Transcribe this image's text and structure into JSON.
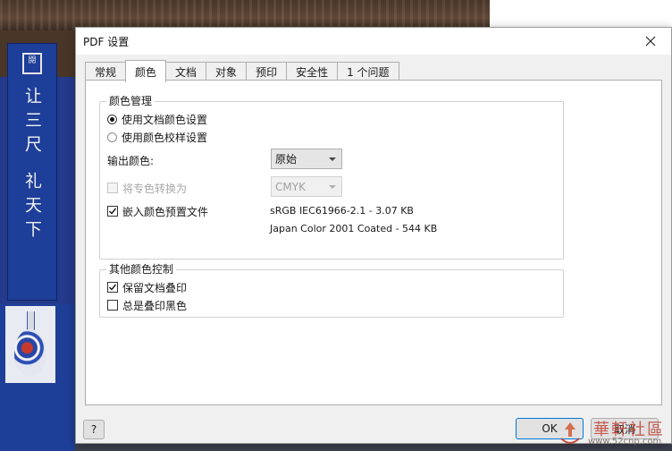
{
  "background": {
    "banner_seal": "閱",
    "banner_line1": "让三尺",
    "banner_line2": "礼天下",
    "watermark": "華軒社區",
    "watermark_url": "www.52cnp.com"
  },
  "dialog": {
    "title": "PDF 设置",
    "tabs": [
      {
        "label": "常规"
      },
      {
        "label": "颜色",
        "active": true
      },
      {
        "label": "文档"
      },
      {
        "label": "对象"
      },
      {
        "label": "预印"
      },
      {
        "label": "安全性"
      },
      {
        "label": "1 个问题"
      }
    ],
    "color_management": {
      "legend": "颜色管理",
      "radio_document": "使用文档颜色设置",
      "radio_document_selected": true,
      "radio_proof": "使用颜色校样设置",
      "radio_proof_selected": false,
      "output_color_label": "输出颜色:",
      "output_color_value": "原始",
      "convert_spot_label": "将专色转换为",
      "convert_spot_checked": false,
      "convert_spot_value": "CMYK",
      "embed_profile_label": "嵌入颜色预置文件",
      "embed_profile_checked": true,
      "profile_rgb": "sRGB IEC61966-2.1 - 3.07 KB",
      "profile_cmyk": "Japan Color 2001 Coated - 544 KB"
    },
    "other_color": {
      "legend": "其他颜色控制",
      "preserve_overprint_label": "保留文档叠印",
      "preserve_overprint_checked": true,
      "always_overprint_black_label": "总是叠印黑色",
      "always_overprint_black_checked": false
    },
    "buttons": {
      "help": "?",
      "ok": "OK",
      "cancel": "取消"
    }
  },
  "icons": {
    "close": "close-icon",
    "check": "checkmark-icon",
    "dropdown": "chevron-down-icon"
  },
  "colors": {
    "dialog_bg": "#f0f0f0",
    "tab_panel_bg": "#ffffff",
    "ok_border": "#0078d7",
    "banner_blue": "#1d3e99"
  }
}
